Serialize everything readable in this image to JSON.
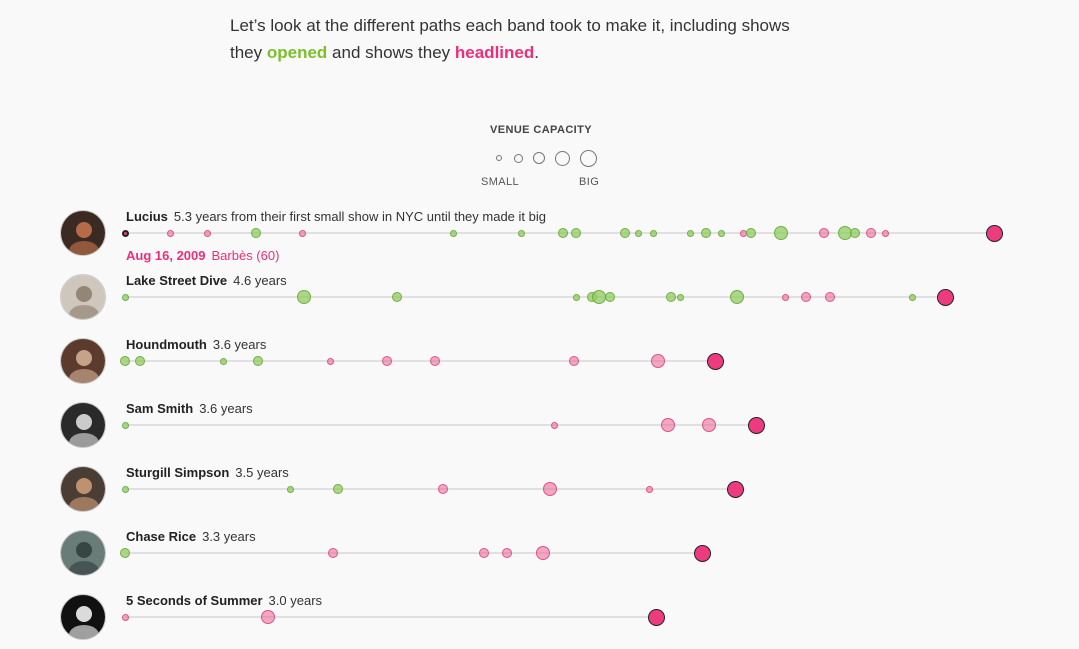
{
  "intro": {
    "line1": "Let’s look at the different paths each band took to make it, including shows",
    "line2_pre": "they ",
    "opened_word": "opened",
    "line2_mid": " and shows they ",
    "headlined_word": "headlined",
    "line2_post": "."
  },
  "legend": {
    "title": "VENUE CAPACITY",
    "small_label": "SMALL",
    "big_label": "BIG",
    "sizes": [
      "smallest",
      "small",
      "medium",
      "large",
      "largest"
    ]
  },
  "colors": {
    "opened": "#7cbf2a",
    "headlined": "#ec2f7a",
    "track": "#e0e0e0"
  },
  "tooltip": {
    "date": "Aug 16, 2009",
    "venue": "Barbès (60)"
  },
  "chart_data": {
    "type": "scatter",
    "x_unit": "years from first small NYC show",
    "size_encoding": "venue capacity",
    "color_encoding": {
      "opened": "green",
      "headlined": "pink"
    },
    "bands": [
      {
        "name": "Lucius",
        "years_label": "5.3 years from their first small show in NYC until they made it big",
        "years": 5.3,
        "shows": [
          {
            "x": 0.0,
            "type": "headlined",
            "size": 1,
            "selected": true
          },
          {
            "x": 0.28,
            "type": "headlined",
            "size": 1
          },
          {
            "x": 0.5,
            "type": "headlined",
            "size": 1
          },
          {
            "x": 0.8,
            "type": "opened",
            "size": 2
          },
          {
            "x": 1.08,
            "type": "headlined",
            "size": 1
          },
          {
            "x": 2.0,
            "type": "opened",
            "size": 1
          },
          {
            "x": 2.42,
            "type": "opened",
            "size": 1
          },
          {
            "x": 2.67,
            "type": "opened",
            "size": 2
          },
          {
            "x": 2.75,
            "type": "opened",
            "size": 2
          },
          {
            "x": 3.05,
            "type": "opened",
            "size": 2
          },
          {
            "x": 3.13,
            "type": "opened",
            "size": 1
          },
          {
            "x": 3.22,
            "type": "opened",
            "size": 1
          },
          {
            "x": 3.45,
            "type": "opened",
            "size": 1
          },
          {
            "x": 3.54,
            "type": "opened",
            "size": 2
          },
          {
            "x": 3.64,
            "type": "opened",
            "size": 1
          },
          {
            "x": 3.77,
            "type": "headlined",
            "size": 1
          },
          {
            "x": 3.82,
            "type": "opened",
            "size": 2
          },
          {
            "x": 4.0,
            "type": "opened",
            "size": 3
          },
          {
            "x": 4.26,
            "type": "headlined",
            "size": 2
          },
          {
            "x": 4.39,
            "type": "opened",
            "size": 3
          },
          {
            "x": 4.45,
            "type": "opened",
            "size": 2
          },
          {
            "x": 4.55,
            "type": "headlined",
            "size": 2
          },
          {
            "x": 4.64,
            "type": "headlined",
            "size": 1
          },
          {
            "x": 5.3,
            "type": "final",
            "size": 4
          }
        ]
      },
      {
        "name": "Lake Street Dive",
        "years_label": "4.6 years",
        "years": 4.6,
        "shows": [
          {
            "x": 0.0,
            "type": "opened",
            "size": 1
          },
          {
            "x": 1.09,
            "type": "opened",
            "size": 3
          },
          {
            "x": 1.66,
            "type": "opened",
            "size": 2
          },
          {
            "x": 2.75,
            "type": "opened",
            "size": 1
          },
          {
            "x": 2.85,
            "type": "opened",
            "size": 2
          },
          {
            "x": 2.89,
            "type": "opened",
            "size": 3
          },
          {
            "x": 2.96,
            "type": "opened",
            "size": 2
          },
          {
            "x": 3.33,
            "type": "opened",
            "size": 2
          },
          {
            "x": 3.39,
            "type": "opened",
            "size": 1
          },
          {
            "x": 3.73,
            "type": "opened",
            "size": 3
          },
          {
            "x": 4.03,
            "type": "headlined",
            "size": 1
          },
          {
            "x": 4.15,
            "type": "headlined",
            "size": 2
          },
          {
            "x": 4.3,
            "type": "headlined",
            "size": 2
          },
          {
            "x": 4.8,
            "type": "opened",
            "size": 1
          },
          {
            "x": 5.0,
            "type": "final",
            "size": 4
          }
        ]
      },
      {
        "name": "Houndmouth",
        "years_label": "3.6 years",
        "years": 3.6,
        "shows": [
          {
            "x": 0.0,
            "type": "opened",
            "size": 2
          },
          {
            "x": 0.09,
            "type": "opened",
            "size": 2
          },
          {
            "x": 0.6,
            "type": "opened",
            "size": 1
          },
          {
            "x": 0.81,
            "type": "opened",
            "size": 2
          },
          {
            "x": 1.25,
            "type": "headlined",
            "size": 1
          },
          {
            "x": 1.6,
            "type": "headlined",
            "size": 2
          },
          {
            "x": 1.89,
            "type": "headlined",
            "size": 2
          },
          {
            "x": 2.74,
            "type": "headlined",
            "size": 2
          },
          {
            "x": 3.25,
            "type": "headlined",
            "size": 3
          },
          {
            "x": 3.6,
            "type": "final",
            "size": 4
          }
        ]
      },
      {
        "name": "Sam Smith",
        "years_label": "3.6 years",
        "years": 3.6,
        "shows": [
          {
            "x": 0.0,
            "type": "opened",
            "size": 1
          },
          {
            "x": 2.62,
            "type": "headlined",
            "size": 1
          },
          {
            "x": 3.31,
            "type": "headlined",
            "size": 3
          },
          {
            "x": 3.56,
            "type": "headlined",
            "size": 3
          },
          {
            "x": 3.85,
            "type": "final",
            "size": 4
          }
        ]
      },
      {
        "name": "Sturgill Simpson",
        "years_label": "3.5 years",
        "years": 3.5,
        "shows": [
          {
            "x": 0.0,
            "type": "opened",
            "size": 1
          },
          {
            "x": 1.01,
            "type": "opened",
            "size": 1
          },
          {
            "x": 1.3,
            "type": "opened",
            "size": 2
          },
          {
            "x": 1.94,
            "type": "headlined",
            "size": 2
          },
          {
            "x": 2.59,
            "type": "headlined",
            "size": 3
          },
          {
            "x": 3.2,
            "type": "headlined",
            "size": 1
          },
          {
            "x": 3.72,
            "type": "final",
            "size": 4
          }
        ]
      },
      {
        "name": "Chase Rice",
        "years_label": "3.3 years",
        "years": 3.3,
        "shows": [
          {
            "x": 0.0,
            "type": "opened",
            "size": 2
          },
          {
            "x": 1.27,
            "type": "headlined",
            "size": 2
          },
          {
            "x": 2.19,
            "type": "headlined",
            "size": 2
          },
          {
            "x": 2.33,
            "type": "headlined",
            "size": 2
          },
          {
            "x": 2.55,
            "type": "headlined",
            "size": 3
          },
          {
            "x": 3.52,
            "type": "final",
            "size": 4
          }
        ]
      },
      {
        "name": "5 Seconds of Summer",
        "years_label": "3.0 years",
        "years": 3.0,
        "shows": [
          {
            "x": 0.0,
            "type": "headlined",
            "size": 1
          },
          {
            "x": 0.87,
            "type": "headlined",
            "size": 3
          },
          {
            "x": 3.24,
            "type": "final",
            "size": 4
          }
        ]
      }
    ]
  }
}
